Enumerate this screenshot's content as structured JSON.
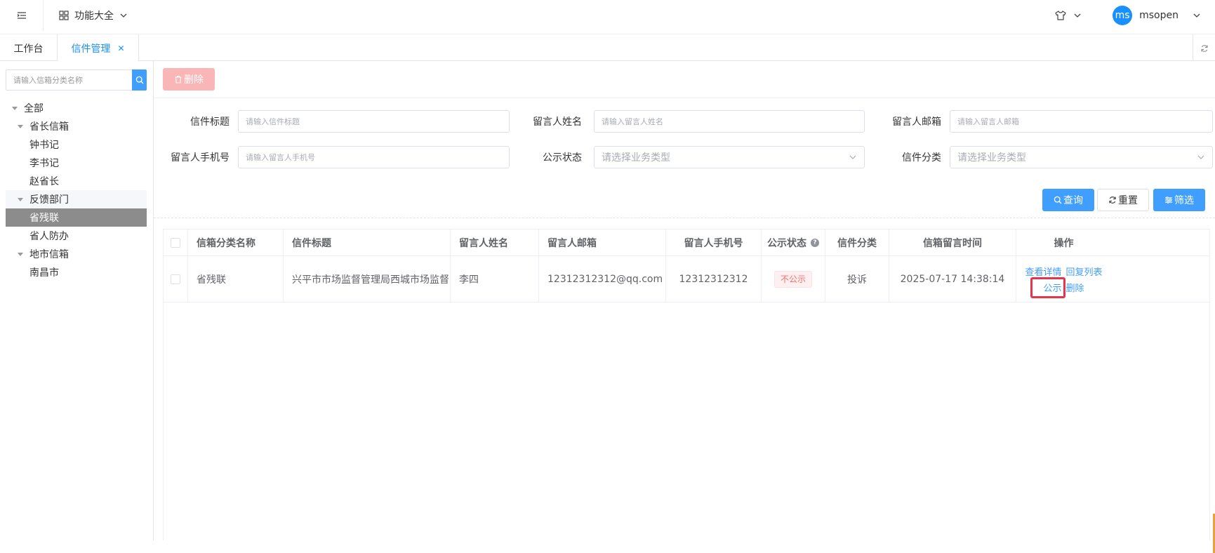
{
  "topbar": {
    "func_all_label": "功能大全",
    "username": "msopen",
    "avatar_text": "ms"
  },
  "tabs": {
    "home_label": "工作台",
    "active_label": "信件管理",
    "close_glyph": "✕"
  },
  "sidebar": {
    "search_placeholder": "请输入信箱分类名称",
    "tree": [
      {
        "label": "全部",
        "level": 0,
        "expanded": true
      },
      {
        "label": "省长信箱",
        "level": 1,
        "expanded": true
      },
      {
        "label": "钟书记",
        "level": 2
      },
      {
        "label": "李书记",
        "level": 2
      },
      {
        "label": "赵省长",
        "level": 2
      },
      {
        "label": "反馈部门",
        "level": 1,
        "expanded": true
      },
      {
        "label": "省残联",
        "level": 2,
        "selected": true
      },
      {
        "label": "省人防办",
        "level": 2
      },
      {
        "label": "地市信箱",
        "level": 1,
        "expanded": true
      },
      {
        "label": "南昌市",
        "level": 2
      }
    ]
  },
  "toolbar": {
    "delete_label": "删除"
  },
  "filters": {
    "title_label": "信件标题",
    "title_placeholder": "请输入信件标题",
    "name_label": "留言人姓名",
    "name_placeholder": "请输入留言人姓名",
    "email_label": "留言人邮箱",
    "email_placeholder": "请输入留言人邮箱",
    "phone_label": "留言人手机号",
    "phone_placeholder": "请输入留言人手机号",
    "public_label": "公示状态",
    "public_placeholder": "请选择业务类型",
    "category_label": "信件分类",
    "category_placeholder": "请选择业务类型",
    "query_label": "查询",
    "reset_label": "重置",
    "filter_label": "筛选"
  },
  "table": {
    "headers": {
      "category": "信箱分类名称",
      "title": "信件标题",
      "name": "留言人姓名",
      "email": "留言人邮箱",
      "phone": "留言人手机号",
      "public": "公示状态",
      "type": "信件分类",
      "time": "信箱留言时间",
      "ops": "操作"
    },
    "rows": [
      {
        "category": "省残联",
        "title": "兴平市市场监督管理局西城市场监督...",
        "name": "李四",
        "email": "12312312312@qq.com",
        "phone": "12312312312",
        "public": "不公示",
        "type": "投诉",
        "time": "2025-07-17 14:38:14",
        "ops": {
          "detail": "查看详情",
          "reply": "回复列表",
          "publish": "公示",
          "delete": "删除"
        }
      }
    ]
  },
  "colors": {
    "primary": "#409eff",
    "danger_light": "#fab6b6",
    "highlight_box": "#e8334a"
  }
}
